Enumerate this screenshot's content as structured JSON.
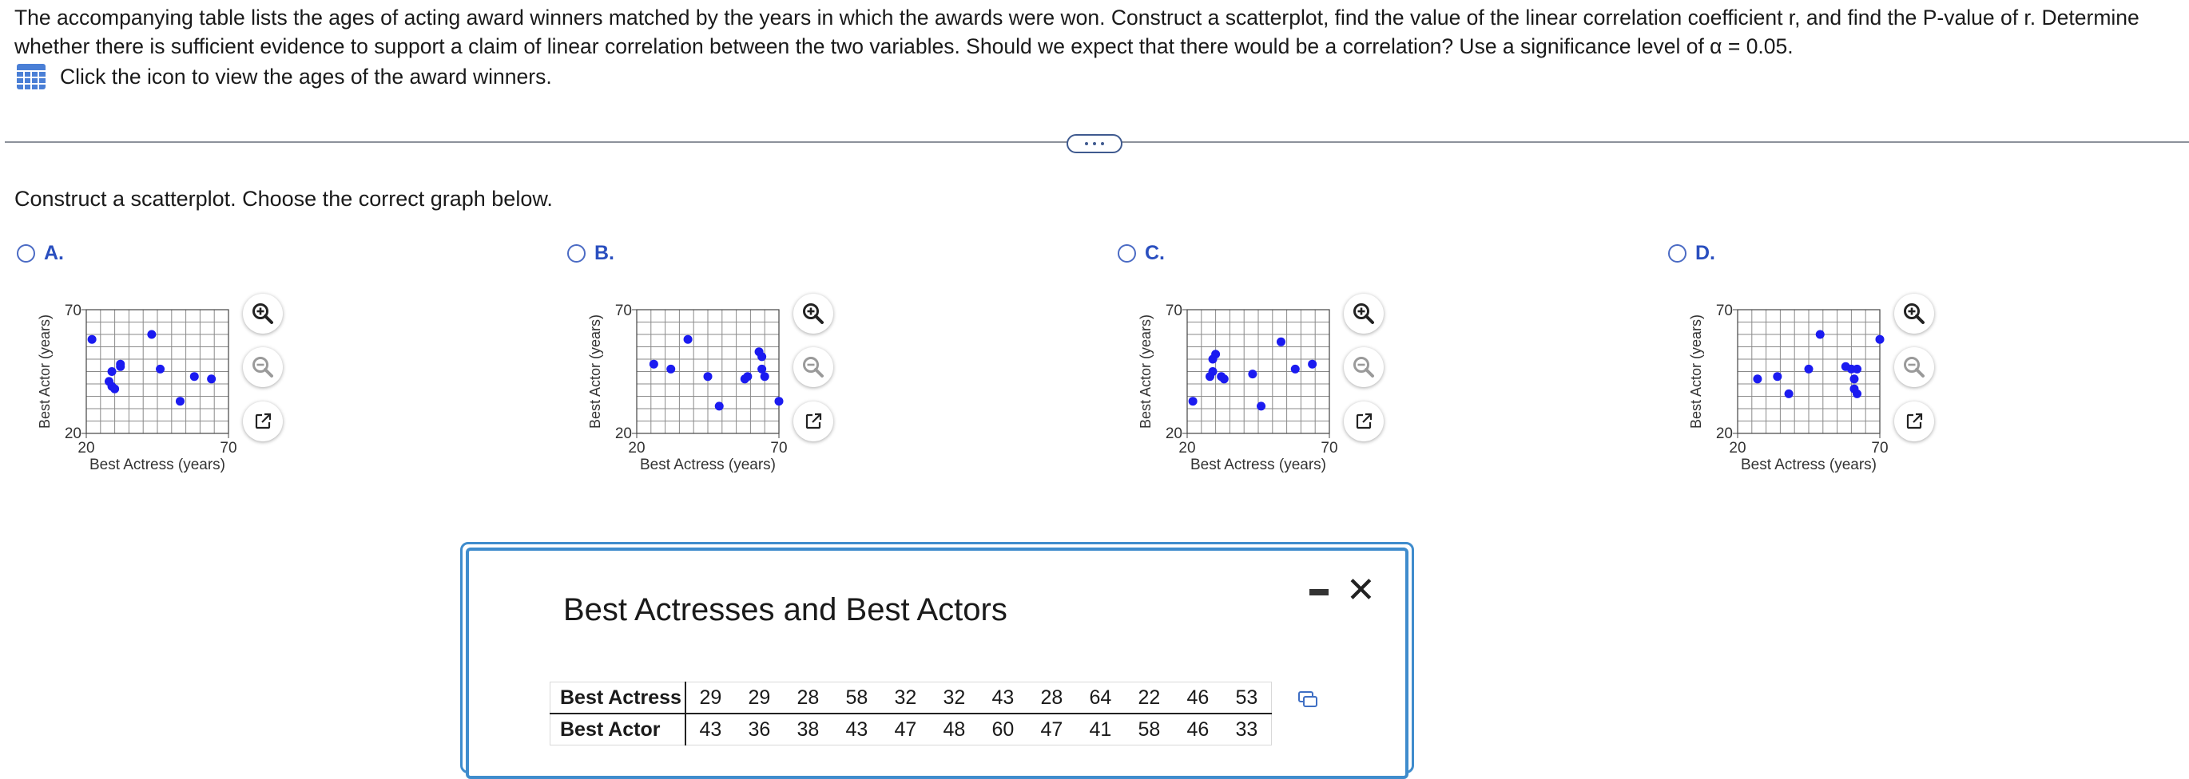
{
  "problem": {
    "text": "The accompanying table lists the ages of acting award winners matched by the years in which the awards were won. Construct a scatterplot, find the value of the linear correlation coefficient r, and find the P-value of r. Determine whether there is sufficient evidence to support a claim of linear correlation between the two variables. Should we expect that there would be a correlation? Use a significance level of α = 0.05.",
    "view_link": "Click the icon to view the ages of the award winners."
  },
  "question": "Construct a scatterplot. Choose the correct graph below.",
  "axes": {
    "xlabel": "Best Actress (years)",
    "ylabel": "Best Actor (years)",
    "xmin": 20,
    "xmax": 70,
    "ymin": 20,
    "ymax": 70,
    "xtick_min": "20",
    "xtick_max": "70",
    "ytick_min": "20",
    "ytick_max": "70"
  },
  "options": [
    {
      "letter": "A.",
      "points": [
        [
          22,
          58
        ],
        [
          29,
          45
        ],
        [
          29,
          39
        ],
        [
          28,
          41
        ],
        [
          30,
          38
        ],
        [
          32,
          47
        ],
        [
          32,
          48
        ],
        [
          43,
          60
        ],
        [
          46,
          46
        ],
        [
          53,
          33
        ],
        [
          58,
          43
        ],
        [
          64,
          42
        ]
      ]
    },
    {
      "letter": "B.",
      "points": [
        [
          26,
          48
        ],
        [
          32,
          46
        ],
        [
          38,
          58
        ],
        [
          45,
          43
        ],
        [
          49,
          31
        ],
        [
          58,
          42
        ],
        [
          59,
          43
        ],
        [
          63,
          53
        ],
        [
          64,
          51
        ],
        [
          64,
          46
        ],
        [
          65,
          43
        ],
        [
          70,
          33
        ]
      ]
    },
    {
      "letter": "C.",
      "points": [
        [
          22,
          33
        ],
        [
          28,
          43
        ],
        [
          29,
          50
        ],
        [
          29,
          45
        ],
        [
          30,
          52
        ],
        [
          32,
          43
        ],
        [
          33,
          42
        ],
        [
          43,
          44
        ],
        [
          46,
          31
        ],
        [
          53,
          57
        ],
        [
          58,
          46
        ],
        [
          64,
          48
        ]
      ]
    },
    {
      "letter": "D.",
      "points": [
        [
          27,
          42
        ],
        [
          34,
          43
        ],
        [
          38,
          36
        ],
        [
          45,
          46
        ],
        [
          49,
          60
        ],
        [
          58,
          47
        ],
        [
          60,
          46
        ],
        [
          61,
          42
        ],
        [
          61,
          38
        ],
        [
          62,
          36
        ],
        [
          62,
          46
        ],
        [
          70,
          58
        ]
      ]
    }
  ],
  "popup": {
    "title": "Best Actresses and Best Actors",
    "row1_label": "Best Actress",
    "row2_label": "Best Actor",
    "actress": [
      "29",
      "29",
      "28",
      "58",
      "32",
      "32",
      "43",
      "28",
      "64",
      "22",
      "46",
      "53"
    ],
    "actor": [
      "43",
      "36",
      "38",
      "43",
      "47",
      "48",
      "60",
      "47",
      "41",
      "58",
      "46",
      "33"
    ]
  },
  "colors": {
    "accent": "#2a4fbf",
    "point": "#1b1bf0",
    "popup_border": "#3f8ccd"
  },
  "icons": {
    "table": "table-icon",
    "zoom_in": "zoom-in-icon",
    "zoom_out": "zoom-out-icon",
    "expand": "external-link-icon",
    "copy": "copy-icon",
    "close": "close-icon",
    "minimize": "minimize-icon"
  }
}
